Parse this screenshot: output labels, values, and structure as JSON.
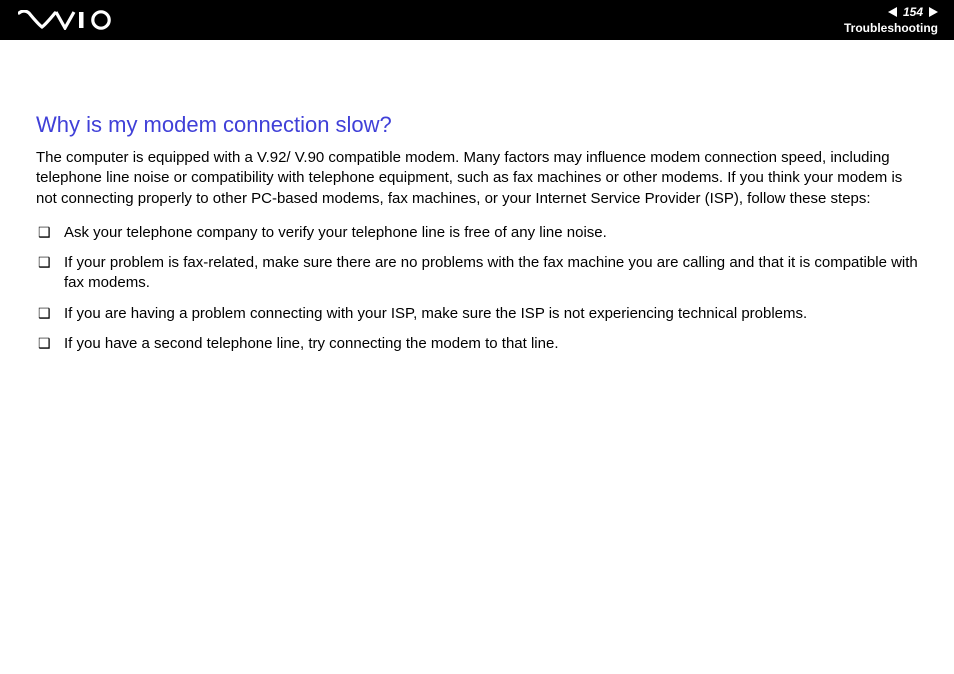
{
  "header": {
    "page_number": "154",
    "section": "Troubleshooting"
  },
  "content": {
    "title": "Why is my modem connection slow?",
    "intro": "The computer is equipped with a V.92/ V.90 compatible modem. Many factors may influence modem connection speed, including telephone line noise or compatibility with telephone equipment, such as fax machines or other modems. If you think your modem is not connecting properly to other PC-based modems, fax machines, or your Internet Service Provider (ISP), follow these steps:",
    "steps": [
      "Ask your telephone company to verify your telephone line is free of any line noise.",
      "If your problem is fax-related, make sure there are no problems with the fax machine you are calling and that it is compatible with fax modems.",
      "If you are having a problem connecting with your ISP, make sure the ISP is not experiencing technical problems.",
      "If you have a second telephone line, try connecting the modem to that line."
    ]
  }
}
